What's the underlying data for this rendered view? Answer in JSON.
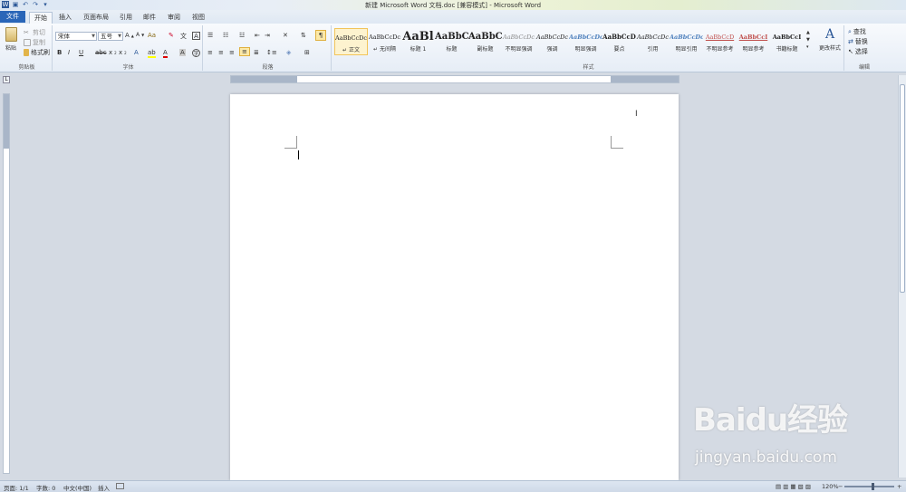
{
  "window": {
    "title": "新建 Microsoft Word 文档.doc [兼容模式] - Microsoft Word"
  },
  "tabs": [
    "文件",
    "开始",
    "插入",
    "页面布局",
    "引用",
    "邮件",
    "审阅",
    "视图"
  ],
  "clipboard": {
    "paste": "粘贴",
    "cut": "剪切",
    "copy": "复制",
    "format_painter": "格式刷",
    "label": "剪贴板"
  },
  "font": {
    "name": "宋体",
    "size": "五号",
    "label": "字体"
  },
  "paragraph": {
    "label": "段落"
  },
  "styles": {
    "label": "样式",
    "items": [
      {
        "sample": "AaBbCcDc",
        "label": "↵ 正文",
        "active": true
      },
      {
        "sample": "AaBbCcDc",
        "label": "↵ 无间隔"
      },
      {
        "sample": "AaBl",
        "label": "标题 1"
      },
      {
        "sample": "AaBbC",
        "label": "标题"
      },
      {
        "sample": "AaBbC",
        "label": "副标题"
      },
      {
        "sample": "AaBbCcDc",
        "label": "不明显强调"
      },
      {
        "sample": "AaBbCcDc",
        "label": "强调"
      },
      {
        "sample": "AaBbCcDc",
        "label": "明显强调"
      },
      {
        "sample": "AaBbCcD",
        "label": "要点"
      },
      {
        "sample": "AaBbCcDc",
        "label": "引用"
      },
      {
        "sample": "AaBbCcDc",
        "label": "明显引用"
      },
      {
        "sample": "AaBbCcD",
        "label": "不明显参考"
      },
      {
        "sample": "AaBbCcI",
        "label": "明显参考"
      },
      {
        "sample": "AaBbCcI",
        "label": "书籍标题"
      }
    ],
    "change_styles": "更改样式"
  },
  "editing": {
    "find": "查找",
    "replace": "替换",
    "select": "选择",
    "label": "编辑"
  },
  "status": {
    "page": "页面: 1/1",
    "words": "字数: 0",
    "lang": "中文(中国)",
    "mode": "插入",
    "zoom": "120%"
  },
  "watermark": {
    "brand": "Baidu经验",
    "url": "jingyan.baidu.com"
  }
}
